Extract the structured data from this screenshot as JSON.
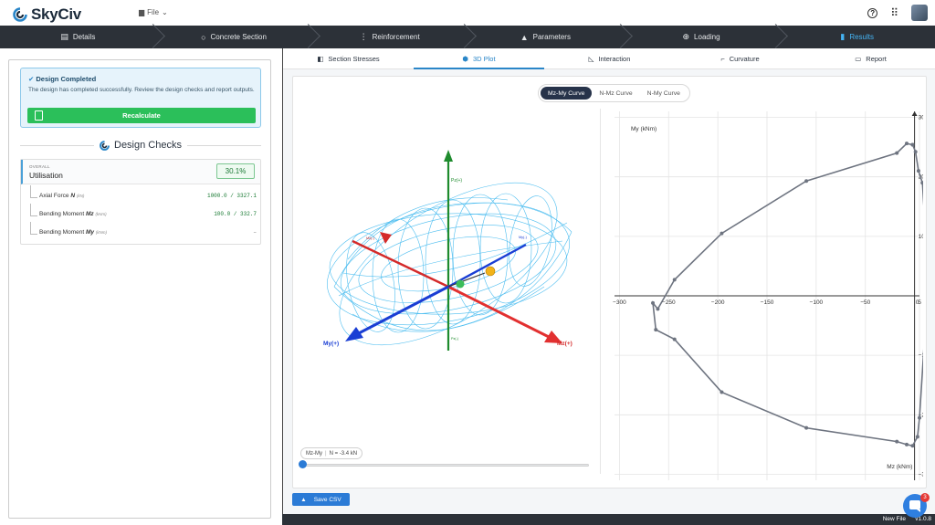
{
  "app": {
    "name": "SkyCiv",
    "file_menu": "File"
  },
  "steps": [
    {
      "label": "Details",
      "icon": "clipboard-icon",
      "active": false
    },
    {
      "label": "Concrete Section",
      "icon": "circle-icon",
      "active": false
    },
    {
      "label": "Reinforcement",
      "icon": "dots-icon",
      "active": false
    },
    {
      "label": "Parameters",
      "icon": "triangle-icon",
      "active": false
    },
    {
      "label": "Loading",
      "icon": "target-icon",
      "active": false
    },
    {
      "label": "Results",
      "icon": "document-icon",
      "active": true
    }
  ],
  "alert": {
    "title": "Design Completed",
    "text": "The design has completed successfully. Review the design checks and report outputs.",
    "button": "Recalculate"
  },
  "design_checks": {
    "title": "Design Checks",
    "overall_label": "OVERALL",
    "utilisation_label": "Utilisation",
    "utilisation_value": "30.1%",
    "rows": [
      {
        "label": "Axial Force",
        "symbol": "N",
        "sub": "(kN)",
        "value": "1000.0 / 3327.1"
      },
      {
        "label": "Bending Moment",
        "symbol": "Mz",
        "sub": "(kNm)",
        "value": "100.0 / 332.7"
      },
      {
        "label": "Bending Moment",
        "symbol": "My",
        "sub": "(kNm)",
        "value": "–"
      }
    ]
  },
  "tabs": [
    {
      "label": "Section Stresses",
      "icon": "stress-icon",
      "active": false
    },
    {
      "label": "3D Plot",
      "icon": "cube-icon",
      "active": true
    },
    {
      "label": "Interaction",
      "icon": "interaction-icon",
      "active": false
    },
    {
      "label": "Curvature",
      "icon": "curvature-icon",
      "active": false
    },
    {
      "label": "Report",
      "icon": "report-icon",
      "active": false
    }
  ],
  "curve_toggle": [
    {
      "label": "Mz-My Curve",
      "active": true
    },
    {
      "label": "N-Mz Curve",
      "active": false
    },
    {
      "label": "N-My Curve",
      "active": false
    }
  ],
  "plot3d": {
    "axis_top": "Pz(+)",
    "axis_my": "My(+)",
    "axis_mz": "Mz(+)",
    "axis_small_left": "Mz(-)",
    "axis_small_right": "My(-)",
    "axis_small_bottom": "Pz(-)"
  },
  "slider": {
    "label": "Mz-My",
    "value": "N = -3.4 kN",
    "fraction": 0.0
  },
  "save_csv": "Save CSV",
  "footer": {
    "file": "New File",
    "version": "v1.0.8"
  },
  "chat_badge": "3",
  "chart_data": {
    "type": "line",
    "title": "",
    "xlabel": "Mz (kNm)",
    "ylabel": "My (kNm)",
    "xlim": [
      -305,
      5
    ],
    "ylim": [
      -310,
      310
    ],
    "xticks": [
      -300,
      -250,
      -200,
      -150,
      -100,
      -50,
      0,
      5
    ],
    "yticks": [
      300,
      200,
      100,
      -100,
      -200,
      -300
    ],
    "series": [
      {
        "x": [
          -2,
          -8,
          -18,
          -110,
          -196,
          -244,
          -261,
          -266,
          -263,
          -244,
          -196,
          -110,
          -18,
          -8,
          -2,
          3,
          5,
          13,
          11,
          8,
          4,
          1,
          -2
        ],
        "y": [
          254,
          256,
          240,
          193,
          105,
          27,
          -22,
          -12,
          -57,
          -73,
          -162,
          -222,
          -245,
          -250,
          -252,
          -237,
          -205,
          3,
          110,
          190,
          210,
          242,
          254
        ]
      }
    ]
  }
}
